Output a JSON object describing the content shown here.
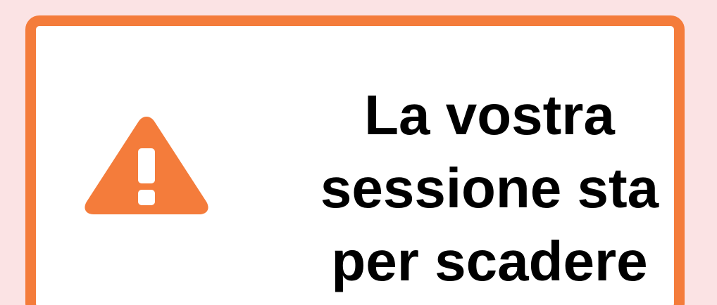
{
  "alert": {
    "icon": "warning-triangle-icon",
    "accent_color": "#f47c3b",
    "background_color": "#fbe3e4",
    "lines": [
      "La vostra",
      "sessione sta",
      "per scadere"
    ]
  }
}
